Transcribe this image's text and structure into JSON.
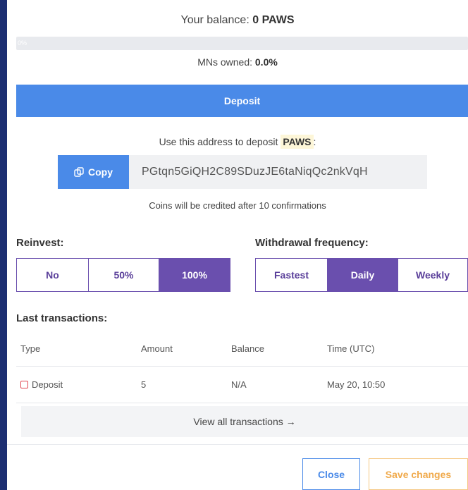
{
  "balance": {
    "prefix": "Your balance: ",
    "value": "0 PAWS"
  },
  "progress": {
    "label": "0%",
    "percent": 0
  },
  "mns": {
    "prefix": "MNs owned: ",
    "value": "0.0%"
  },
  "deposit_tab": {
    "label": "Deposit"
  },
  "address": {
    "intro": "Use this address to deposit",
    "coin": "PAWS",
    "colon": ":",
    "copy_label": "Copy",
    "value": "PGtqn5GiQH2C89SDuzJE6taNiqQc2nkVqH",
    "confirm_note": "Coins will be credited after 10 confirmations"
  },
  "reinvest": {
    "label": "Reinvest:",
    "options": [
      "No",
      "50%",
      "100%"
    ],
    "selected": "100%"
  },
  "withdrawal": {
    "label": "Withdrawal frequency:",
    "options": [
      "Fastest",
      "Daily",
      "Weekly"
    ],
    "selected": "Daily"
  },
  "transactions": {
    "label": "Last transactions:",
    "columns": [
      "Type",
      "Amount",
      "Balance",
      "Time (UTC)"
    ],
    "rows": [
      {
        "type": "Deposit",
        "amount": "5",
        "balance": "N/A",
        "time": "May 20, 10:50"
      }
    ],
    "view_all": "View all transactions →"
  },
  "footer": {
    "close": "Close",
    "save": "Save changes"
  },
  "colors": {
    "accent_blue": "#4a8ae8",
    "purple": "#6a4fae",
    "orange": "#f0a94a",
    "background": "#1d2f72"
  }
}
